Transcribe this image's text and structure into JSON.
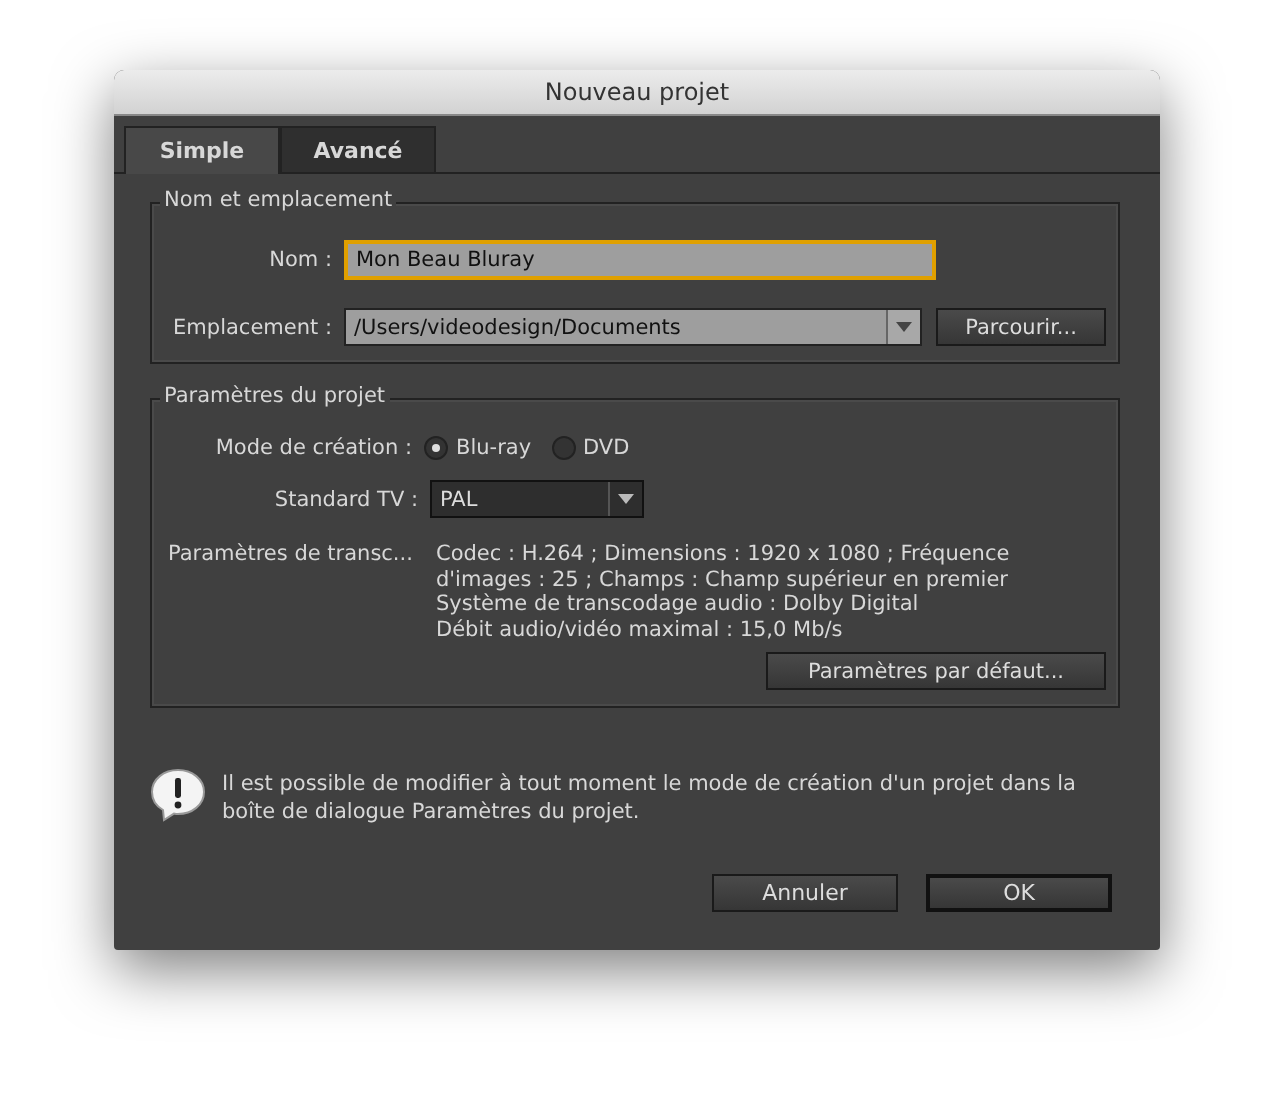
{
  "window": {
    "title": "Nouveau projet"
  },
  "tabs": [
    {
      "label": "Simple",
      "selected": true
    },
    {
      "label": "Avancé",
      "selected": false
    }
  ],
  "location_group": {
    "title": "Nom et emplacement",
    "name_label": "Nom :",
    "name_value": "Mon Beau Bluray",
    "location_label": "Emplacement :",
    "location_value": "/Users/videodesign/Documents",
    "browse_button": "Parcourir..."
  },
  "project_group": {
    "title": "Paramètres du projet",
    "mode_label": "Mode de création :",
    "modes": [
      {
        "label": "Blu-ray",
        "selected": true
      },
      {
        "label": "DVD",
        "selected": false
      }
    ],
    "tv_label": "Standard TV :",
    "tv_value": "PAL",
    "transcode_label": "Paramètres de transc...",
    "transcode_lines": [
      "Codec : H.264 ; Dimensions : 1920 x 1080 ; Fréquence",
      "d'images : 25 ; Champs : Champ supérieur en premier",
      "Système de transcodage audio : Dolby Digital",
      "Débit audio/vidéo maximal : 15,0 Mb/s"
    ],
    "defaults_button": "Paramètres par défaut..."
  },
  "info_lines": [
    "Il est possible de modifier à tout moment le mode de création d'un projet dans la",
    "boîte de dialogue Paramètres du projet."
  ],
  "buttons": [
    {
      "label": "Annuler",
      "kind": "cancel"
    },
    {
      "label": "OK",
      "kind": "default"
    }
  ]
}
